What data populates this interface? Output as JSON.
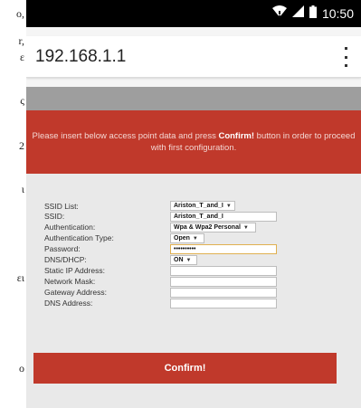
{
  "left_strip": [
    "ο,",
    "r,",
    "ε",
    "ς",
    "2",
    "ι",
    "ει",
    "ο"
  ],
  "status_bar": {
    "time": "10:50"
  },
  "browser": {
    "url": "192.168.1.1"
  },
  "banner": {
    "text_before": "Please insert below access point data and press ",
    "text_bold": "Confirm!",
    "text_after": " button in order to proceed with first configuration."
  },
  "form": {
    "ssid_list": {
      "label": "SSID List:",
      "value": "Ariston_T_and_I"
    },
    "ssid": {
      "label": "SSID:",
      "value": "Ariston_T_and_I"
    },
    "authentication": {
      "label": "Authentication:",
      "value": "Wpa & Wpa2 Personal"
    },
    "authentication_type": {
      "label": "Authentication Type:",
      "value": "Open"
    },
    "password": {
      "label": "Password:",
      "value": "••••••••••"
    },
    "dns_dhcp": {
      "label": "DNS/DHCP:",
      "value": "ON"
    },
    "static_ip": {
      "label": "Static IP Address:",
      "value": ""
    },
    "network_mask": {
      "label": "Network Mask:",
      "value": ""
    },
    "gateway": {
      "label": "Gateway Address:",
      "value": ""
    },
    "dns_address": {
      "label": "DNS Address:",
      "value": ""
    }
  },
  "confirm_button": {
    "label": "Confirm!"
  },
  "colors": {
    "accent": "#c0392b",
    "status_bar": "#000000",
    "header_gray": "#9e9e9e"
  }
}
